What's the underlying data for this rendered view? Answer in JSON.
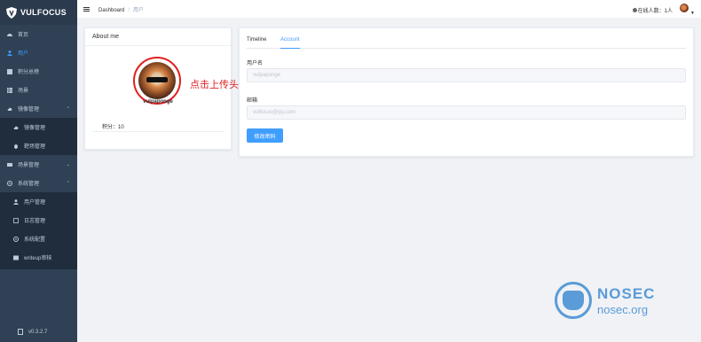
{
  "brand": {
    "name": "VULFOCUS"
  },
  "sidebar": {
    "items": [
      {
        "label": "首页",
        "icon": "dashboard-icon"
      },
      {
        "label": "用户",
        "icon": "user-icon",
        "active": true
      },
      {
        "label": "积分总榜",
        "icon": "rank-icon"
      },
      {
        "label": "场景",
        "icon": "table-icon"
      },
      {
        "label": "镜像管理",
        "icon": "cloud-icon",
        "expanded": true
      },
      {
        "label": "镜像管理",
        "icon": "cloud-icon",
        "sub": true
      },
      {
        "label": "靶场管理",
        "icon": "bug-icon",
        "sub": true
      },
      {
        "label": "场景管理",
        "icon": "scene-icon"
      },
      {
        "label": "系统管理",
        "icon": "gear-icon",
        "expanded": true
      },
      {
        "label": "用户管理",
        "icon": "user-icon",
        "sub": true
      },
      {
        "label": "日志管理",
        "icon": "log-icon",
        "sub": true
      },
      {
        "label": "系统配置",
        "icon": "gear-icon",
        "sub": true
      },
      {
        "label": "writeup审核",
        "icon": "doc-icon",
        "sub": true
      }
    ],
    "version": "v0.3.2.7"
  },
  "navbar": {
    "breadcrumb_root": "Dashboard",
    "breadcrumb_sep": "/",
    "breadcrumb_current": "用户",
    "online": "在线人数：1人"
  },
  "about": {
    "title": "About me",
    "username": "vulpaponge",
    "upload_hint": "点击上传头像",
    "score": "积分：10"
  },
  "account": {
    "tabs": [
      "Timeline",
      "Account"
    ],
    "active_tab": "Account",
    "username_label": "用户名",
    "username_value": "vulpaponge",
    "email_label": "邮箱",
    "email_value": "vulfocus@qq.com",
    "button": "修改密码"
  },
  "watermark": {
    "line1": "NOSEC",
    "line2": "nosec.org"
  },
  "colors": {
    "sidebar": "#304156",
    "accent": "#409eff",
    "annotation": "#e02020"
  }
}
